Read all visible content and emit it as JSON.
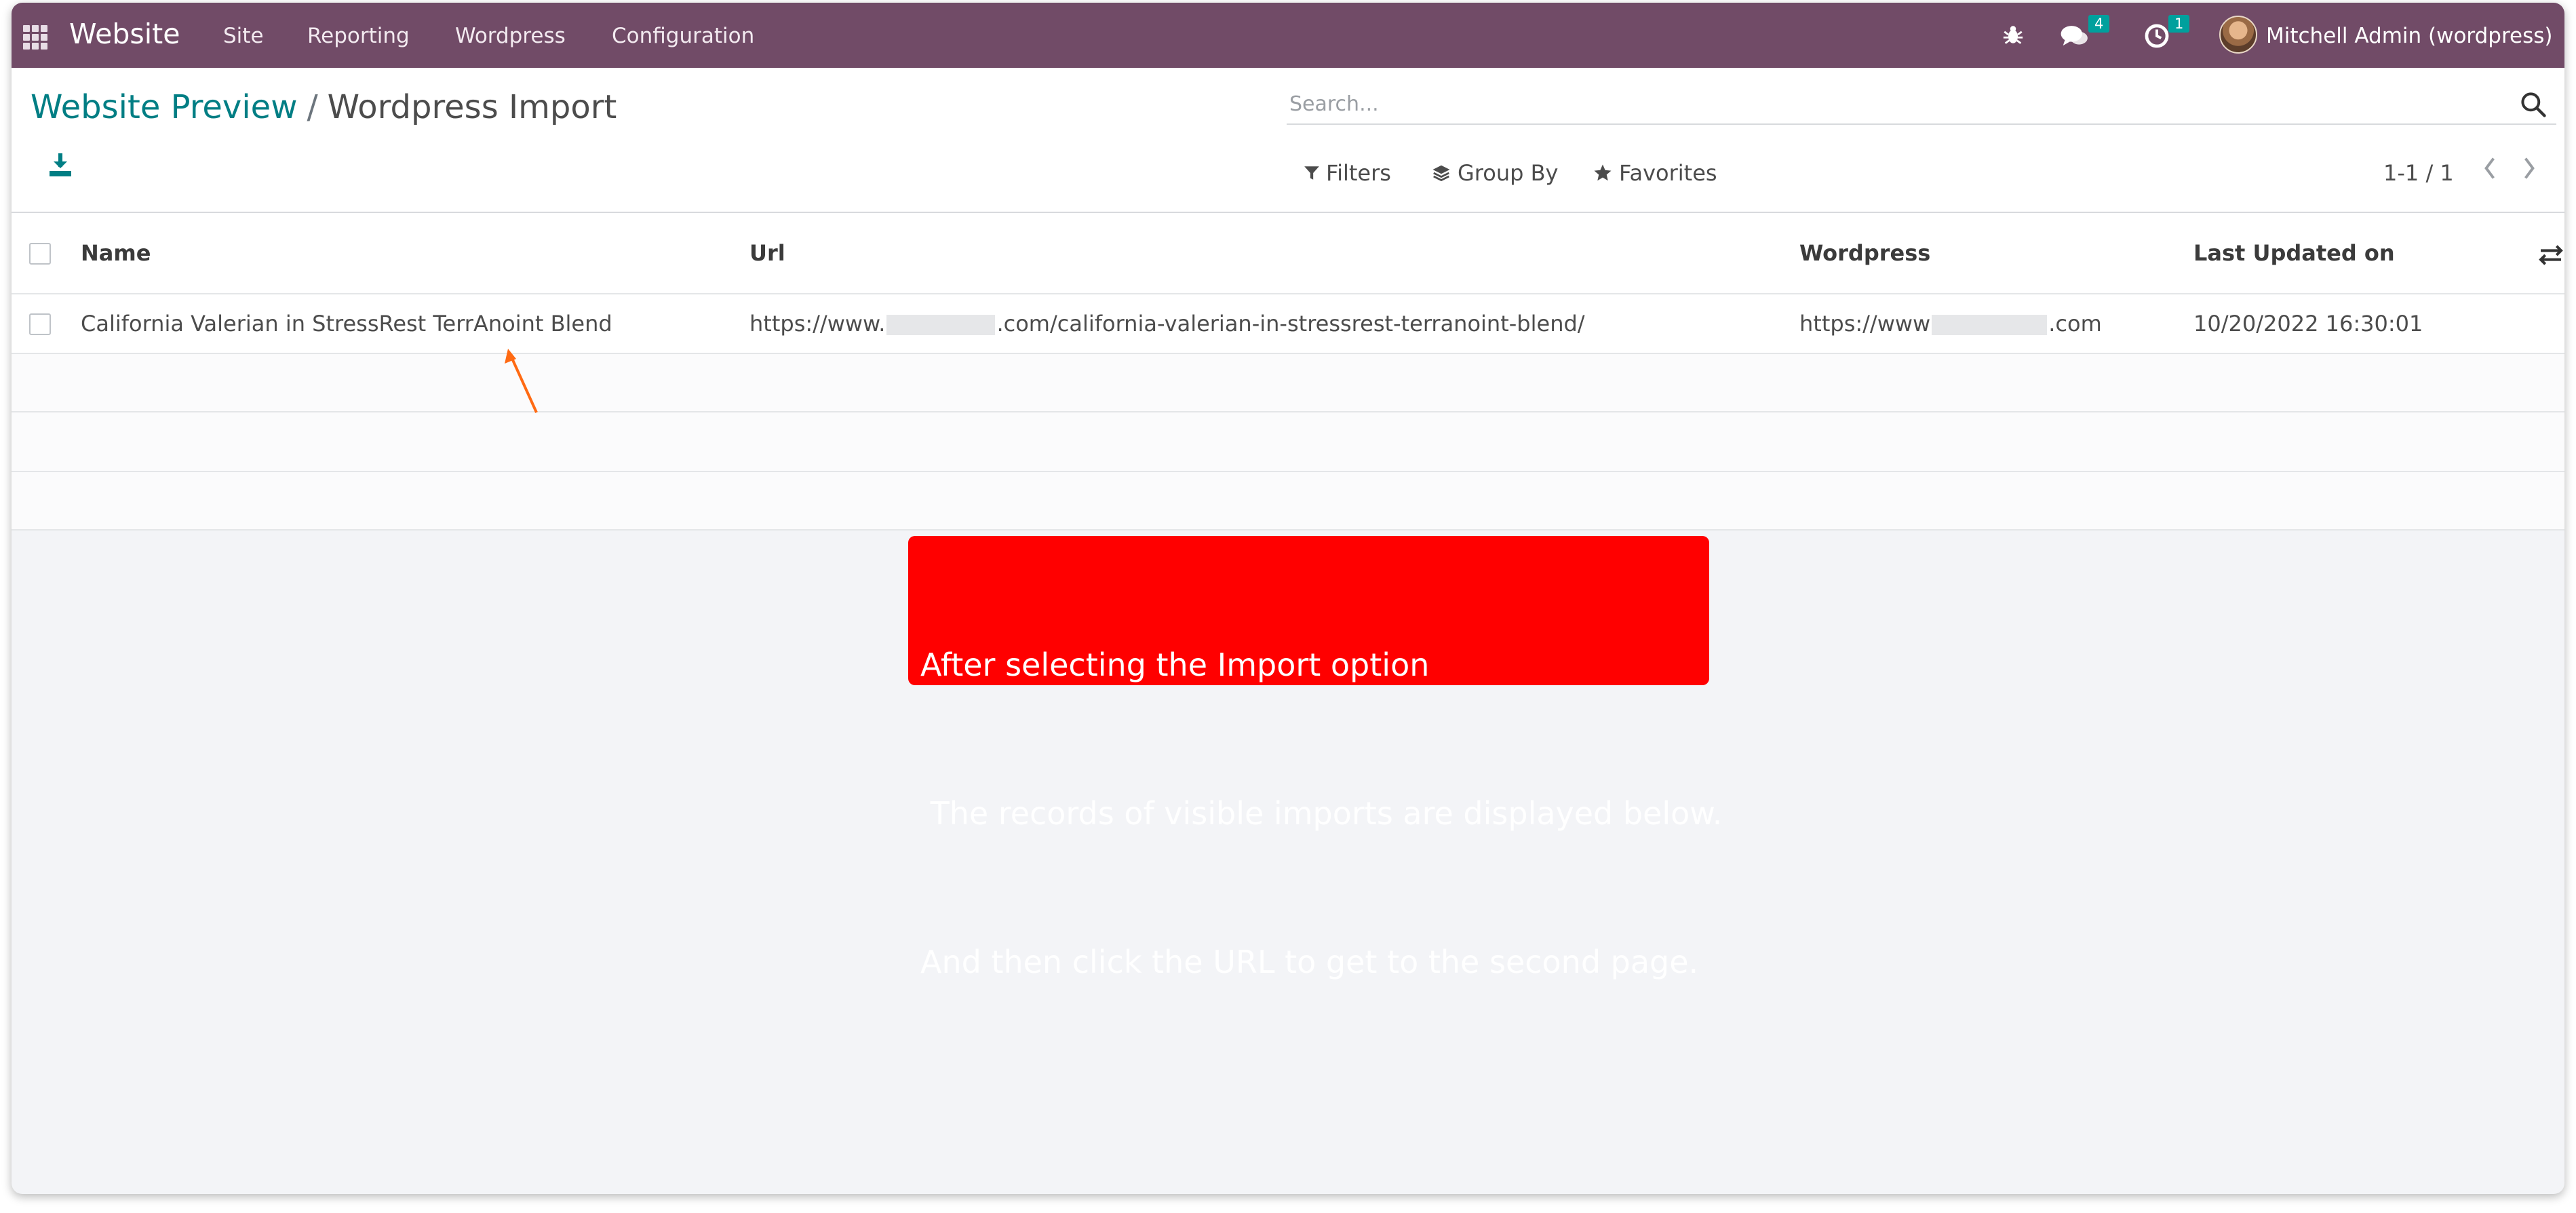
{
  "navbar": {
    "app_name": "Website",
    "menu": [
      "Site",
      "Reporting",
      "Wordpress",
      "Configuration"
    ],
    "messages_badge": "4",
    "activities_badge": "1",
    "user": "Mitchell Admin (wordpress)",
    "color": "#714b67"
  },
  "breadcrumb": {
    "parent": "Website Preview",
    "separator": "/",
    "current": "Wordpress Import"
  },
  "search": {
    "placeholder": "Search..."
  },
  "filters": {
    "filters_label": "Filters",
    "group_by_label": "Group By",
    "favorites_label": "Favorites"
  },
  "pager": {
    "value": "1-1 / 1"
  },
  "table": {
    "columns": [
      "Name",
      "Url",
      "Wordpress",
      "Last Updated on"
    ],
    "rows": [
      {
        "name": "California Valerian in StressRest TerrAnoint Blend",
        "url_prefix": "https://www.",
        "url_suffix": ".com/california-valerian-in-stressrest-terranoint-blend/",
        "wordpress_prefix": "https://www",
        "wordpress_suffix": ".com",
        "last_updated": "10/20/2022 16:30:01"
      }
    ]
  },
  "annotation": {
    "line1": "After selecting the Import option",
    "line2": " The records of visible imports are displayed below.",
    "line3": "And then click the URL to get to the second page.",
    "color": "#ff0000",
    "arrow_color": "#ff6a13"
  }
}
